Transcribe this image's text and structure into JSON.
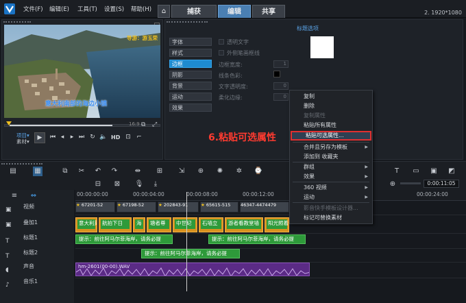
{
  "menu": [
    "文件(F)",
    "编辑(E)",
    "工具(T)",
    "设置(S)",
    "帮助(H)"
  ],
  "tabs": [
    "捕获",
    "编辑",
    "共享"
  ],
  "resolution": "2. 1920*1080",
  "preview": {
    "caption_top": "导游：游玉荣",
    "caption_bottom": "意大利南部的海边小镇",
    "project_label": "项目▾",
    "clip_label": "素材▾",
    "hd_label": "HD"
  },
  "options": {
    "header": "标题选项",
    "categories": [
      "字体",
      "样式",
      "边框",
      "阴影",
      "背景",
      "运动",
      "效果"
    ],
    "active_category": "边框",
    "props": {
      "transparent_text": "透明文字",
      "outline_border": "外侧笔画框线",
      "border_width": "边框宽度:",
      "border_width_val": "1",
      "line_color": "线条色彩:",
      "text_transparency": "文字透明度:",
      "text_transparency_val": "0",
      "soft_edge": "柔化边缘:",
      "soft_edge_val": "0"
    }
  },
  "context_menu": {
    "items": [
      {
        "label": "复制",
        "state": "normal"
      },
      {
        "label": "删除",
        "state": "normal"
      },
      {
        "label": "复制属性",
        "state": "disabled"
      },
      {
        "label": "粘贴所有属性",
        "state": "normal"
      },
      {
        "label": "粘贴可选属性...",
        "state": "highlighted"
      },
      {
        "label": "合并且另存为模板",
        "state": "submenu"
      },
      {
        "label": "添加到 收藏夹",
        "state": "normal"
      },
      {
        "label": "群组",
        "state": "submenu"
      },
      {
        "label": "效果",
        "state": "submenu"
      },
      {
        "label": "360 视频",
        "state": "submenu"
      },
      {
        "label": "运动",
        "state": "submenu"
      },
      {
        "label": "影音快手模板设计器...",
        "state": "disabled"
      },
      {
        "label": "标记可替换素材",
        "state": "normal"
      }
    ]
  },
  "annotation": "6.粘贴可选属性",
  "timeline": {
    "ruler": [
      "00:00:00:00",
      "00:00:04:00",
      "00:00:08:00",
      "00:00:12:00",
      "00:00:24:00"
    ],
    "timecode": "0:00:11:05",
    "tracks": [
      "视频",
      "叠加1",
      "标题1",
      "标题2",
      "声音",
      "音乐1"
    ],
    "video_clips": [
      "67201-52",
      "67198-52",
      "202843-91",
      "65615-515",
      "46347-4474479"
    ],
    "overlay_clips": [
      "意大利莱",
      "航拍下日",
      "海",
      "塘者尊",
      "中世纪",
      "石墙立",
      "游者看教堂墙",
      "阳光照着"
    ],
    "title1_text": "提示：前往阿马尔菲海岸，请务必提",
    "title1_text_b": "提示：前往阿马尔菲海岸，请务必提",
    "title2_text": "提示：前往阿马尔菲海岸，请务必提",
    "audio_clip": "hm-2601(00-00).WAV"
  },
  "colors": {
    "accent": "#1e8bd0",
    "highlight_border": "#e03030",
    "annotation": "#ff3b30",
    "title_clip": "#2e9a3a",
    "overlay_clip": "#d8911f",
    "audio_clip": "#5b2b86"
  }
}
